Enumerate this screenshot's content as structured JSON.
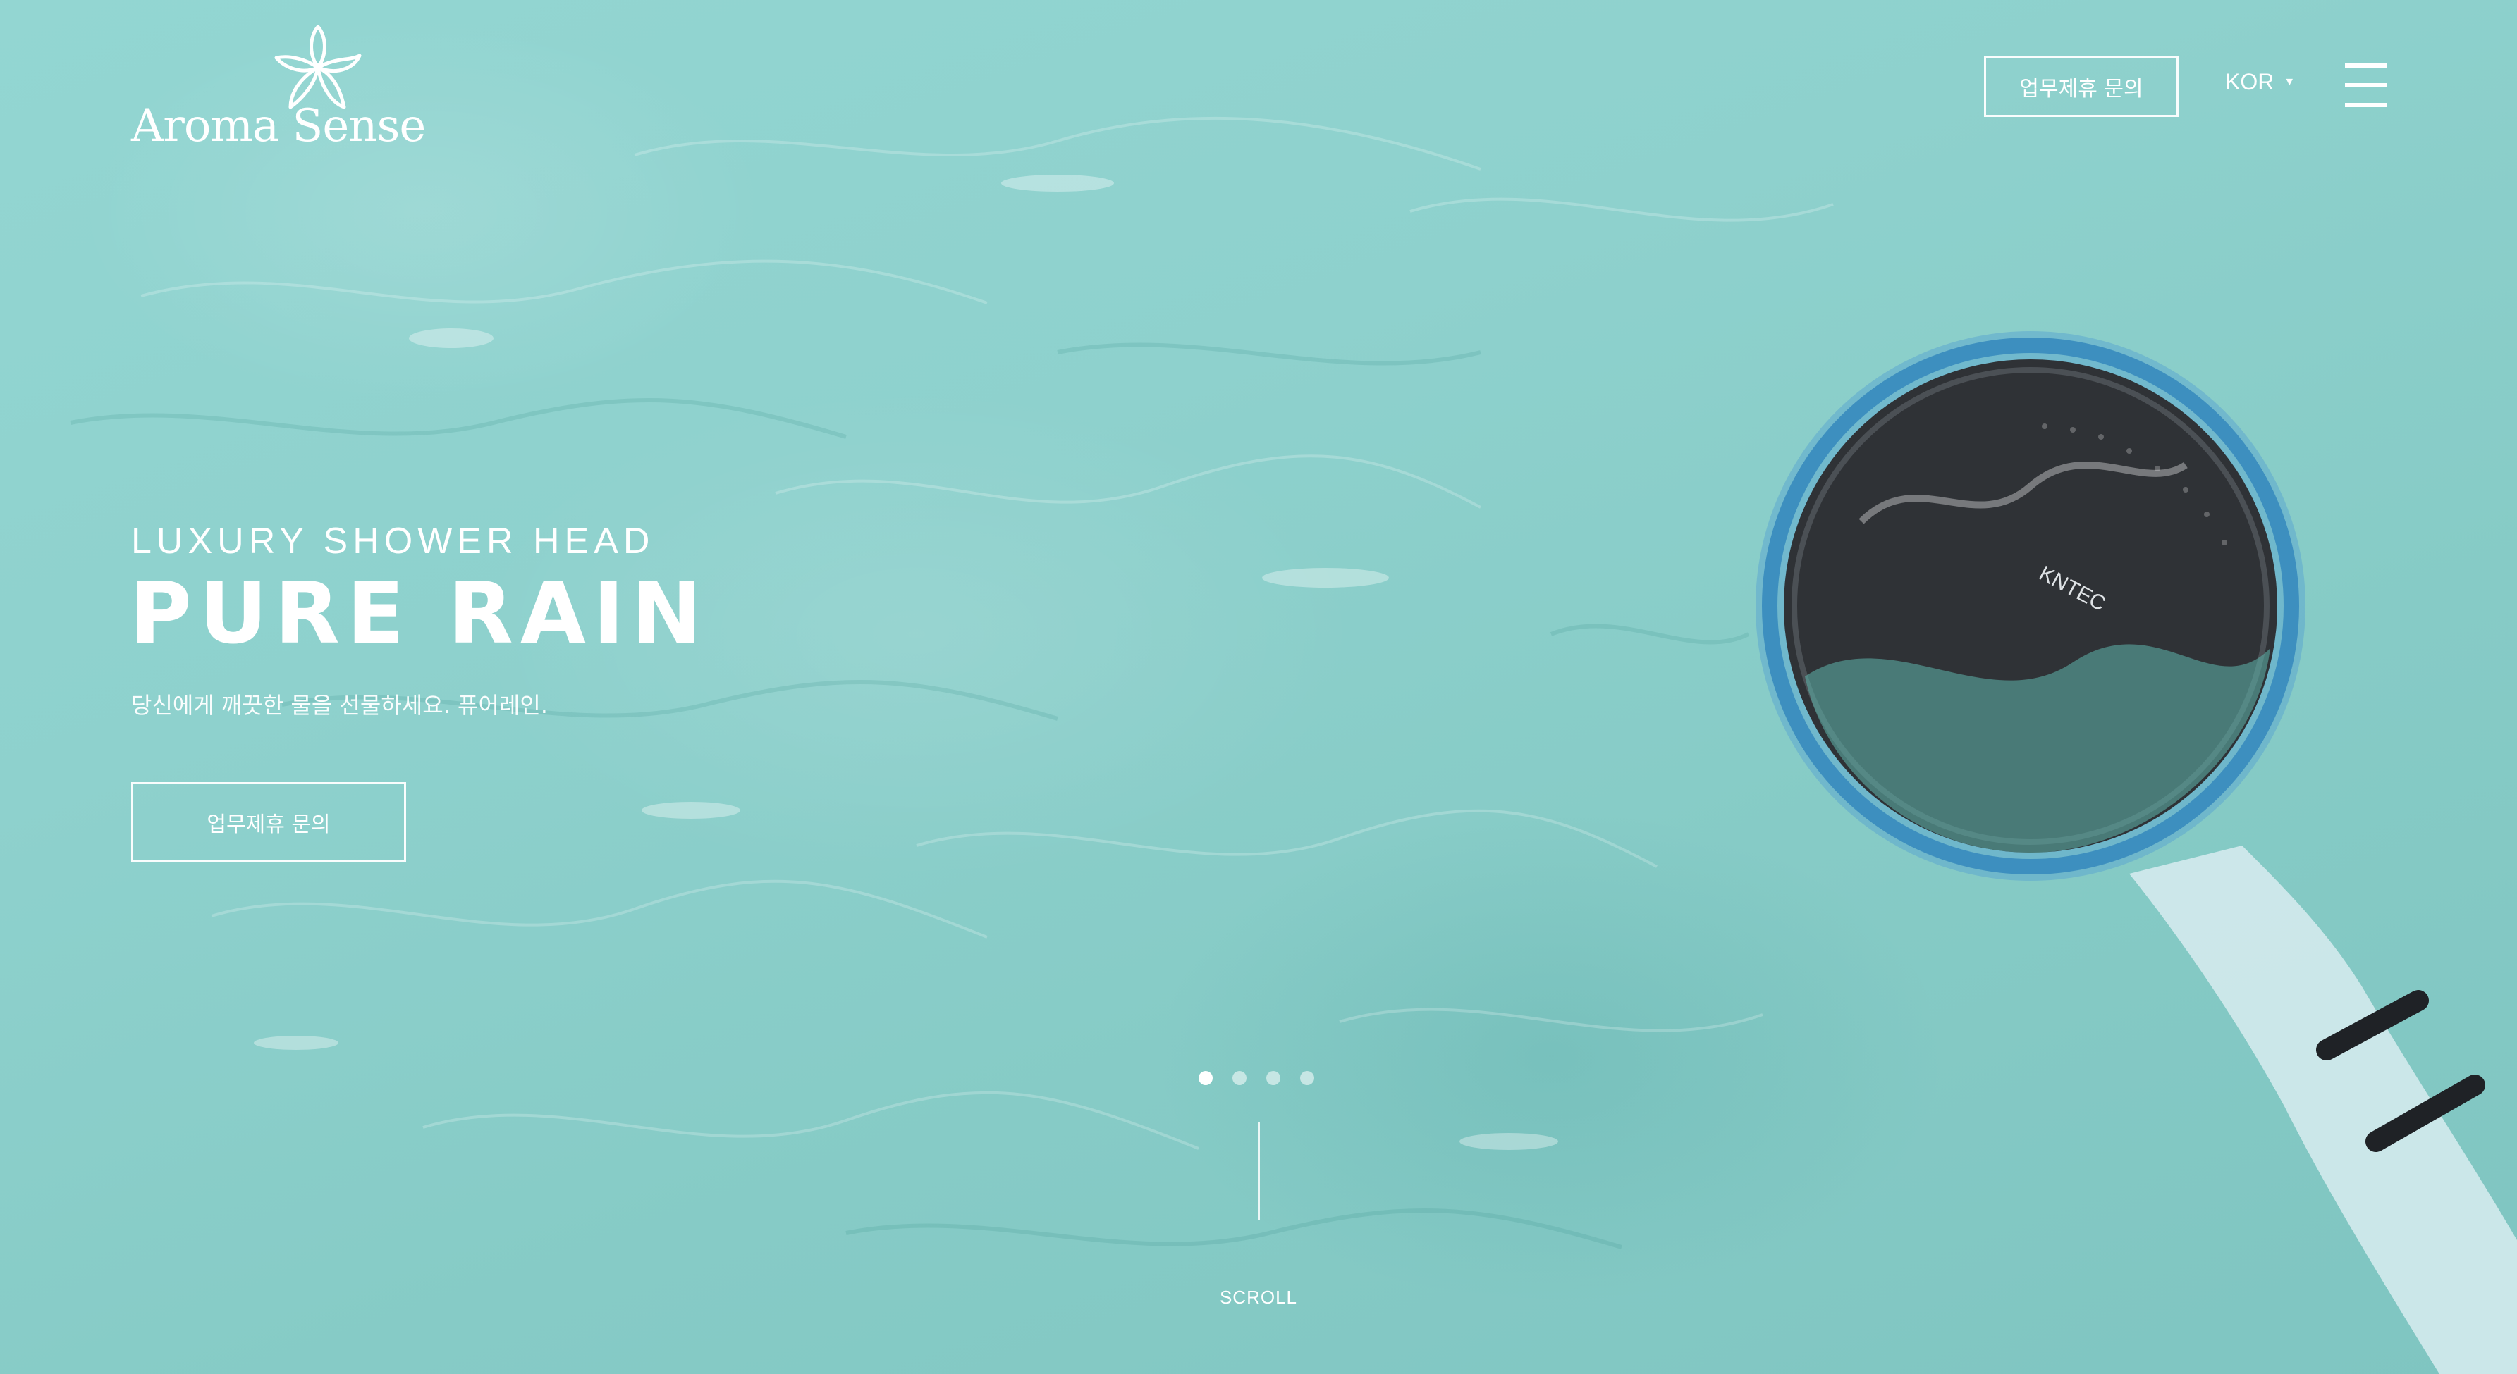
{
  "brand": {
    "name": "Aroma Sense"
  },
  "header": {
    "inquiry_label": "업무제휴 문의",
    "language": "KOR",
    "menu_icon": "hamburger-menu-icon"
  },
  "hero": {
    "eyebrow": "LUXURY SHOWER HEAD",
    "title": "PURE RAIN",
    "tagline": "당신에게 깨끗한 물을 선물하세요. 퓨어레인.",
    "cta_label": "업무제휴 문의",
    "product_mark": "KNTEC"
  },
  "slider": {
    "total": 4,
    "active": 1
  },
  "scroll": {
    "label": "SCROLL"
  },
  "colors": {
    "water": "#8ed1cd",
    "text": "#ffffff",
    "product": "#2f3236"
  }
}
